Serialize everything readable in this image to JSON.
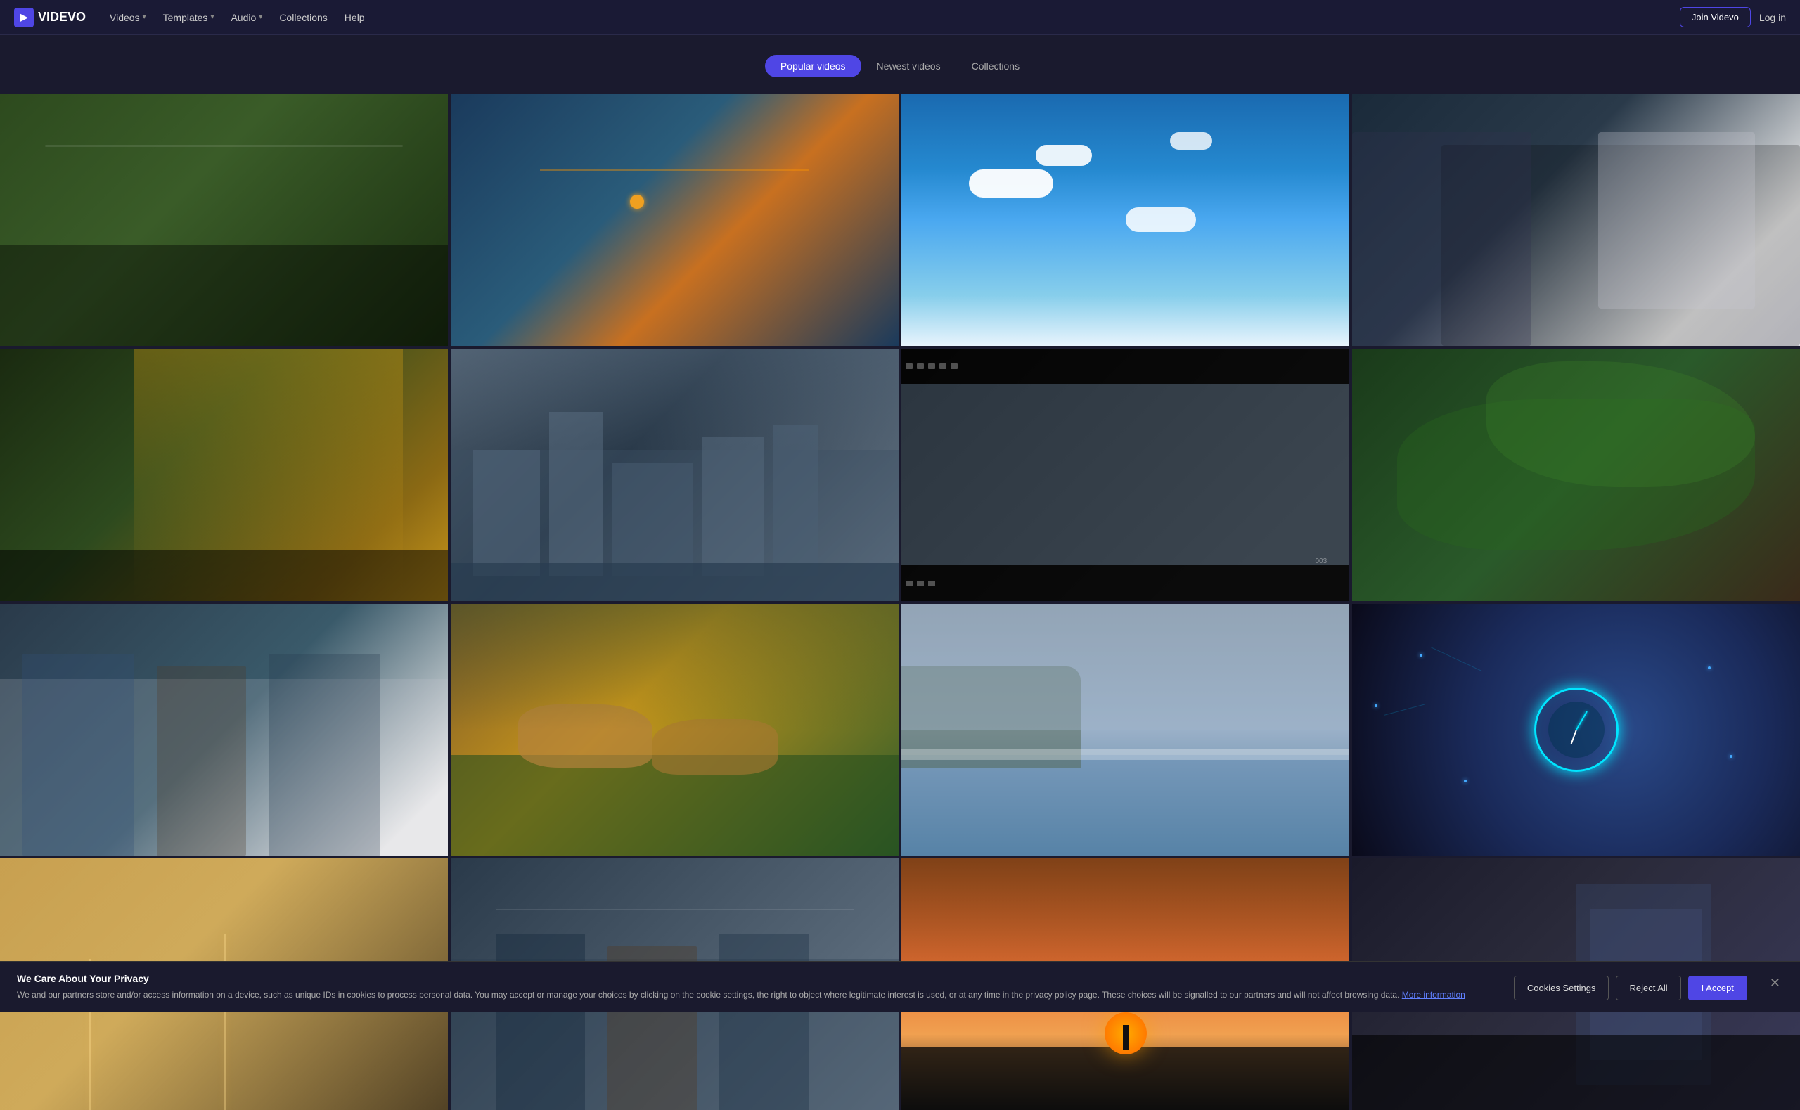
{
  "brand": {
    "logo_text": "VIDEVO",
    "logo_icon": "V"
  },
  "nav": {
    "links": [
      {
        "label": "Videos",
        "has_dropdown": true
      },
      {
        "label": "Templates",
        "has_dropdown": true
      },
      {
        "label": "Audio",
        "has_dropdown": true
      },
      {
        "label": "Collections",
        "has_dropdown": false
      },
      {
        "label": "Help",
        "has_dropdown": false
      }
    ],
    "join_label": "Join Videvo",
    "login_label": "Log in"
  },
  "tabs": {
    "items": [
      {
        "label": "Popular videos",
        "active": true
      },
      {
        "label": "Newest videos",
        "active": false
      },
      {
        "label": "Collections",
        "active": false
      }
    ]
  },
  "grid": {
    "videos": [
      {
        "id": 1,
        "style": "t1",
        "alt": "Forest ground misty"
      },
      {
        "id": 2,
        "style": "t2",
        "alt": "Industrial machinery"
      },
      {
        "id": 3,
        "style": "t3",
        "alt": "Blue sky white clouds"
      },
      {
        "id": 4,
        "style": "t4",
        "alt": "Business people at laptop"
      },
      {
        "id": 5,
        "style": "t5",
        "alt": "Forest sunlight trees"
      },
      {
        "id": 6,
        "style": "t6",
        "alt": "City skyline aerial"
      },
      {
        "id": 7,
        "style": "t7",
        "alt": "Business meeting film strip"
      },
      {
        "id": 8,
        "style": "t8",
        "alt": "Green leaves nature"
      },
      {
        "id": 9,
        "style": "t9",
        "alt": "Office team discussion"
      },
      {
        "id": 10,
        "style": "t10",
        "alt": "Lions walking grass"
      },
      {
        "id": 11,
        "style": "t11",
        "alt": "Coastal cliffs ocean"
      },
      {
        "id": 12,
        "style": "t12",
        "alt": "Digital clock network"
      },
      {
        "id": 13,
        "style": "t13",
        "alt": "Warm light interior"
      },
      {
        "id": 14,
        "style": "t14",
        "alt": "Office people meeting"
      },
      {
        "id": 15,
        "style": "t15",
        "alt": "Sunset silhouette"
      },
      {
        "id": 16,
        "style": "t16",
        "alt": "Person in dark room"
      }
    ]
  },
  "cookie": {
    "title": "We Care About Your Privacy",
    "body": "We and our partners store and/or access information on a device, such as unique IDs in cookies to process personal data. You may accept or manage your choices by clicking on the cookie settings, the right to object where legitimate interest is used, or at any time in the privacy policy page. These choices will be signalled to our partners and will not affect browsing data.",
    "more_info_label": "More information",
    "settings_label": "Cookies Settings",
    "reject_label": "Reject All",
    "accept_label": "I Accept"
  }
}
